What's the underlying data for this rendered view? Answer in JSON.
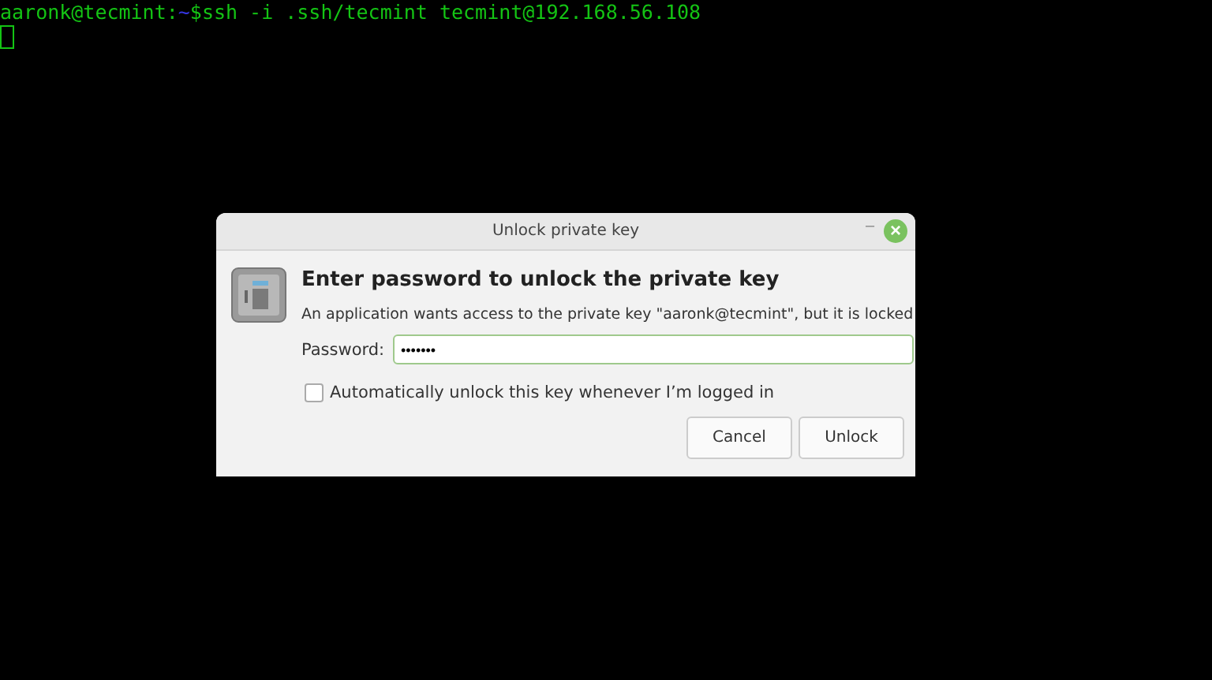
{
  "terminal": {
    "prompt_user_host": "aaronk@tecmint:",
    "prompt_path": "~",
    "prompt_symbol": "$",
    "command": "ssh -i .ssh/tecmint tecmint@192.168.56.108"
  },
  "dialog": {
    "title": "Unlock private key",
    "minimize": "–",
    "close": "×",
    "heading": "Enter password to unlock the private key",
    "message": "An application wants access to the private key \"aaronk@tecmint\", but it is locked",
    "password_label": "Password:",
    "password_value": "•••••••",
    "auto_unlock": {
      "label": "Automatically unlock this key whenever I’m logged in",
      "checked": false
    },
    "buttons": [
      "Cancel",
      "Unlock"
    ]
  }
}
